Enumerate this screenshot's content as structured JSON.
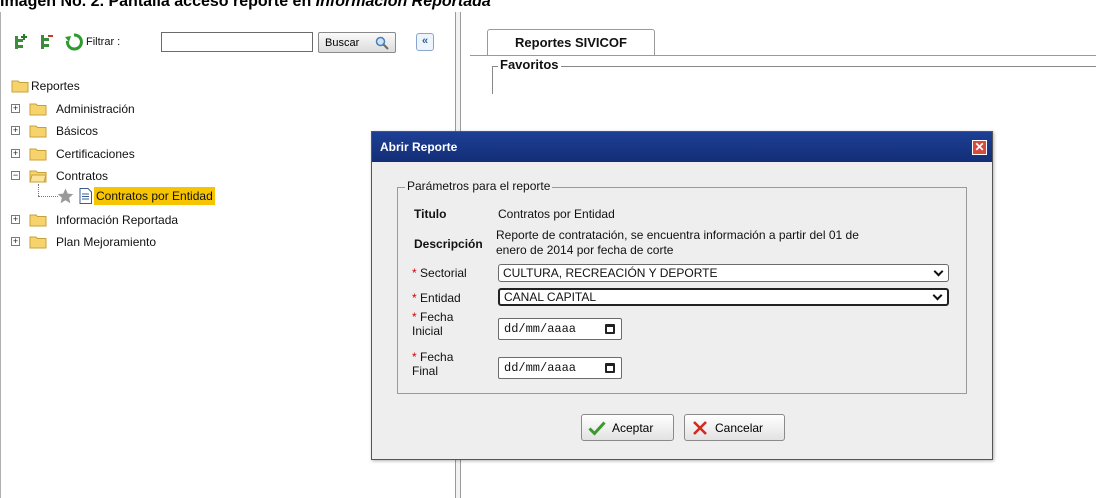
{
  "caption": {
    "prefix": "Imagen No. 2. Pantalla acceso reporte en ",
    "emphasis": "Información Reportada"
  },
  "toolbar": {
    "filter_label": "Filtrar :",
    "filter_value": "",
    "search_button": "Buscar",
    "collapse_button": "«",
    "icons": [
      "add-node-icon",
      "tree-icon",
      "refresh-icon"
    ]
  },
  "tree": {
    "root": "Reportes",
    "items": [
      {
        "label": "Administración",
        "expander": "+"
      },
      {
        "label": "Básicos",
        "expander": "+"
      },
      {
        "label": "Certificaciones",
        "expander": "+"
      },
      {
        "label": "Contratos",
        "expander": "−"
      },
      {
        "label": "Contratos por Entidad",
        "expander": ""
      },
      {
        "label": "Información Reportada",
        "expander": "+"
      },
      {
        "label": "Plan Mejoramiento",
        "expander": "+"
      }
    ],
    "selected_color": "#f6c400"
  },
  "tabs": [
    {
      "label": "Reportes SIVICOF",
      "active": true
    }
  ],
  "favoritos": {
    "legend": "Favoritos"
  },
  "dialog": {
    "title": "Abrir Reporte",
    "close_symbol": "✕",
    "params_legend": "Parámetros para el reporte",
    "titulo_label": "Titulo",
    "titulo_value": "Contratos por Entidad",
    "descripcion_label": "Descripción",
    "descripcion_value_1": "Reporte de contratación, se encuentra información a partir del 01 de",
    "descripcion_value_2": "enero de 2014 por fecha de corte",
    "required_mark": "*",
    "sectorial_label": "Sectorial",
    "sectorial_value": "CULTURA, RECREACIÓN Y DEPORTE",
    "entidad_label": "Entidad",
    "entidad_value": "CANAL CAPITAL",
    "fecha_inicial_label_1": "Fecha",
    "fecha_inicial_label_2": "Inicial",
    "fecha_inicial_value": "dd/mm/aaaa",
    "fecha_final_label_1": "Fecha",
    "fecha_final_label_2": "Final",
    "fecha_final_value": "dd/mm/aaaa",
    "accept_button": "Aceptar",
    "cancel_button": "Cancelar",
    "header_color": "#1a3a8f"
  }
}
